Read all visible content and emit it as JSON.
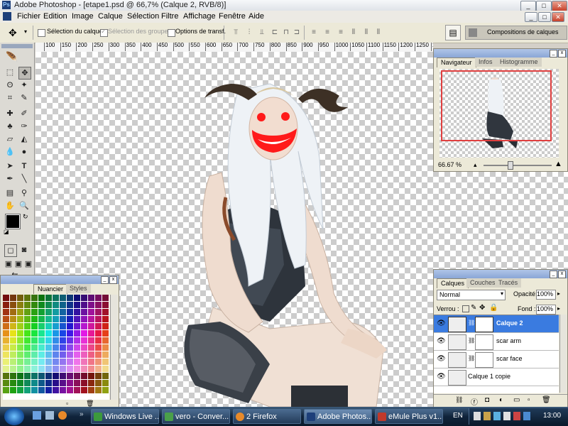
{
  "window": {
    "title": "Adobe Photoshop - [etape1.psd @ 66,7% (Calque 2, RVB/8)]",
    "minimize": "_",
    "maximize": "□",
    "close": "✕",
    "doc_min": "_",
    "doc_max": "□",
    "doc_close": "✕"
  },
  "menu": [
    "Fichier",
    "Edition",
    "Image",
    "Calque",
    "Sélection",
    "Filtre",
    "Affichage",
    "Fenêtre",
    "Aide"
  ],
  "options": {
    "auto_select_label": "Sélection du calque",
    "group_select_label": "Sélection des groupes",
    "transform_label": "Options de transf.",
    "compositions_label": "Compositions de calques"
  },
  "ruler": [
    "100",
    "150",
    "200",
    "250",
    "300",
    "350",
    "400",
    "450",
    "500",
    "550",
    "600",
    "650",
    "700",
    "750",
    "800",
    "850",
    "900",
    "950",
    "1000",
    "1050",
    "1100",
    "1150",
    "1200",
    "1250",
    "1300"
  ],
  "tools_text": {
    "type_tool": "T"
  },
  "navigator": {
    "tabs": [
      "Navigateur",
      "Infos",
      "Histogramme"
    ],
    "zoom": "66.67 %"
  },
  "swatches": {
    "tabs": [
      "Nuancier",
      "Styles"
    ]
  },
  "layers": {
    "tabs": [
      "Calques",
      "Couches",
      "Tracés"
    ],
    "blend_mode": "Normal",
    "opacity_label": "Opacité:",
    "opacity_value": "100%",
    "lock_label": "Verrou :",
    "fill_label": "Fond :",
    "fill_value": "100%",
    "items": [
      {
        "name": "Calque 2",
        "selected": true
      },
      {
        "name": "scar arm",
        "selected": false
      },
      {
        "name": "scar face",
        "selected": false
      },
      {
        "name": "Calque 1 copie",
        "selected": false
      }
    ]
  },
  "taskbar": {
    "items": [
      "Windows Live ...",
      "vero - Conver...",
      "2 Firefox",
      "Adobe Photos...",
      "eMule Plus v1...."
    ],
    "language": "EN",
    "time": "13:00"
  },
  "colors": {
    "accent_selected": "#3a7be0",
    "taskbar": "#10243b",
    "mark_red": "#ff1a1a"
  }
}
